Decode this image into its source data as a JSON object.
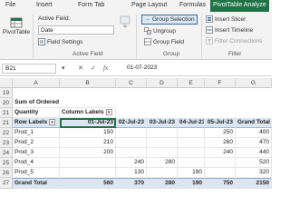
{
  "ribbon_tabs": [
    {
      "label": "File"
    },
    {
      "label": "Insert"
    },
    {
      "label": "Form Tab"
    },
    {
      "label": "Page Layout"
    },
    {
      "label": "Formulas"
    },
    {
      "label": "PivotTable Analyze"
    }
  ],
  "ribbon": {
    "pivottable_label": "PivotTable",
    "active_field_label": "Active Field:",
    "active_field_value": "Date",
    "field_settings_label": "Field Settings",
    "active_field_group_label": "Active Field",
    "group_selection_label": "Group Selection",
    "ungroup_label": "Ungroup",
    "group_field_label": "Group Field",
    "group_label": "Group",
    "insert_slicer_label": "Insert Slicer",
    "insert_timeline_label": "Insert Timeline",
    "filter_connections_label": "Filter Connections",
    "filter_label": "Filter",
    "accent_color": "#217346"
  },
  "formula_bar": {
    "name_box": "B21",
    "formula": "01-07-2023"
  },
  "grid": {
    "columns": [
      "A",
      "B",
      "C",
      "D",
      "E",
      "F",
      "G"
    ],
    "rows": [
      {
        "num": "19",
        "cells": [
          "",
          "",
          "",
          "",
          "",
          "",
          ""
        ]
      },
      {
        "num": "20",
        "cells": [
          "Sum of Ordered",
          "",
          "",
          "",
          "",
          "",
          ""
        ]
      },
      {
        "num": "21",
        "cells": [
          "Quantity",
          "Column Labels",
          "",
          "",
          "",
          "",
          ""
        ]
      },
      {
        "num": "21b",
        "cells": [
          "Row Labels",
          "01-Jul-23",
          "02-Jul-23",
          "03-Jul-23",
          "04-Jul-23",
          "05-Jul-23",
          "Grand Total"
        ]
      },
      {
        "num": "22",
        "cells": [
          "Prod_1",
          "150",
          "",
          "",
          "",
          "250",
          "400"
        ]
      },
      {
        "num": "23",
        "cells": [
          "Prod_2",
          "210",
          "",
          "",
          "",
          "260",
          "470"
        ]
      },
      {
        "num": "24",
        "cells": [
          "Prod_3",
          "200",
          "",
          "",
          "",
          "240",
          "440"
        ]
      },
      {
        "num": "25",
        "cells": [
          "Prod_4",
          "",
          "240",
          "280",
          "",
          "",
          "520"
        ]
      },
      {
        "num": "26",
        "cells": [
          "Prod_5",
          "",
          "130",
          "",
          "190",
          "",
          "320"
        ]
      },
      {
        "num": "27",
        "cells": [
          "Grand Total",
          "560",
          "370",
          "280",
          "190",
          "750",
          "2150"
        ]
      }
    ]
  }
}
